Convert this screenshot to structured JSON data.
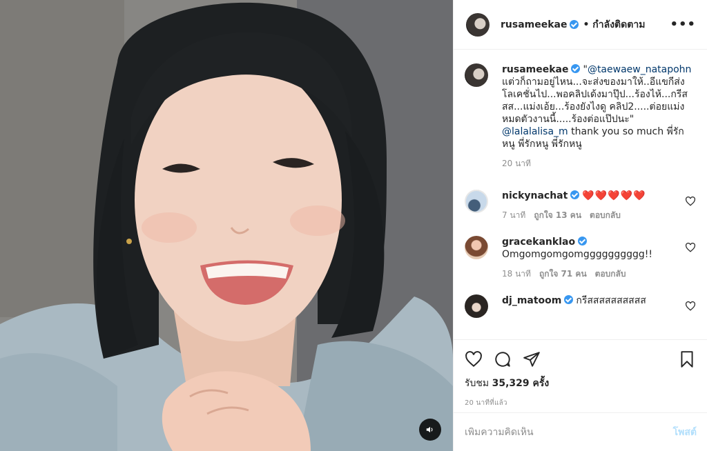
{
  "post": {
    "username": "rusameekae",
    "follow_status": "• กำลังติดตาม",
    "more_icon": "more-dots-icon"
  },
  "caption": {
    "username": "rusameekae",
    "text_quote": "\"",
    "mention1": "@taewaew_natapohn",
    "body": " แต่วก็ถามอยู่ไหน...จะส่งของมาให้..อีแขกีส่งโลเคชั่นไป...พอคลิปเด้งมาปุ๊ป...ร้องไห้...กรีสสส...แม่งเอ้ย...ร้องยังไงดู คลิป2.....ต่อยแม่งหมดตัวงานนี้.....ร้องต่อแป๊ปนะ\" ",
    "mention2": "@lalalalisa_m",
    "tail": " thank you so much  พี่รักหนู  พี่รักหนู  พี่รักหนู",
    "time": "20 นาที"
  },
  "comments": [
    {
      "username": "nickynachat",
      "text": "❤️❤️❤️❤️❤️",
      "time": "7 นาที",
      "likes": "ถูกใจ 13 คน",
      "reply": "ตอบกลับ"
    },
    {
      "username": "gracekanklao",
      "text": "Omgomgomgomgggggggggg!!",
      "time": "18 นาที",
      "likes": "ถูกใจ 71 คน",
      "reply": "ตอบกลับ"
    },
    {
      "username": "dj_matoom",
      "text": "กรีสสสสสสสสสส",
      "time": "",
      "likes": "",
      "reply": ""
    }
  ],
  "stats": {
    "views_label": "รับชม",
    "views_count": "35,329 ครั้ง",
    "posted_ago": "20 นาทีที่แล้ว"
  },
  "add_comment": {
    "placeholder": "เพิ่มความคิดเห็น",
    "post_label": "โพสต์"
  },
  "colors": {
    "verified": "#3897f0",
    "link": "#00376b",
    "heart": "#e0245e"
  }
}
